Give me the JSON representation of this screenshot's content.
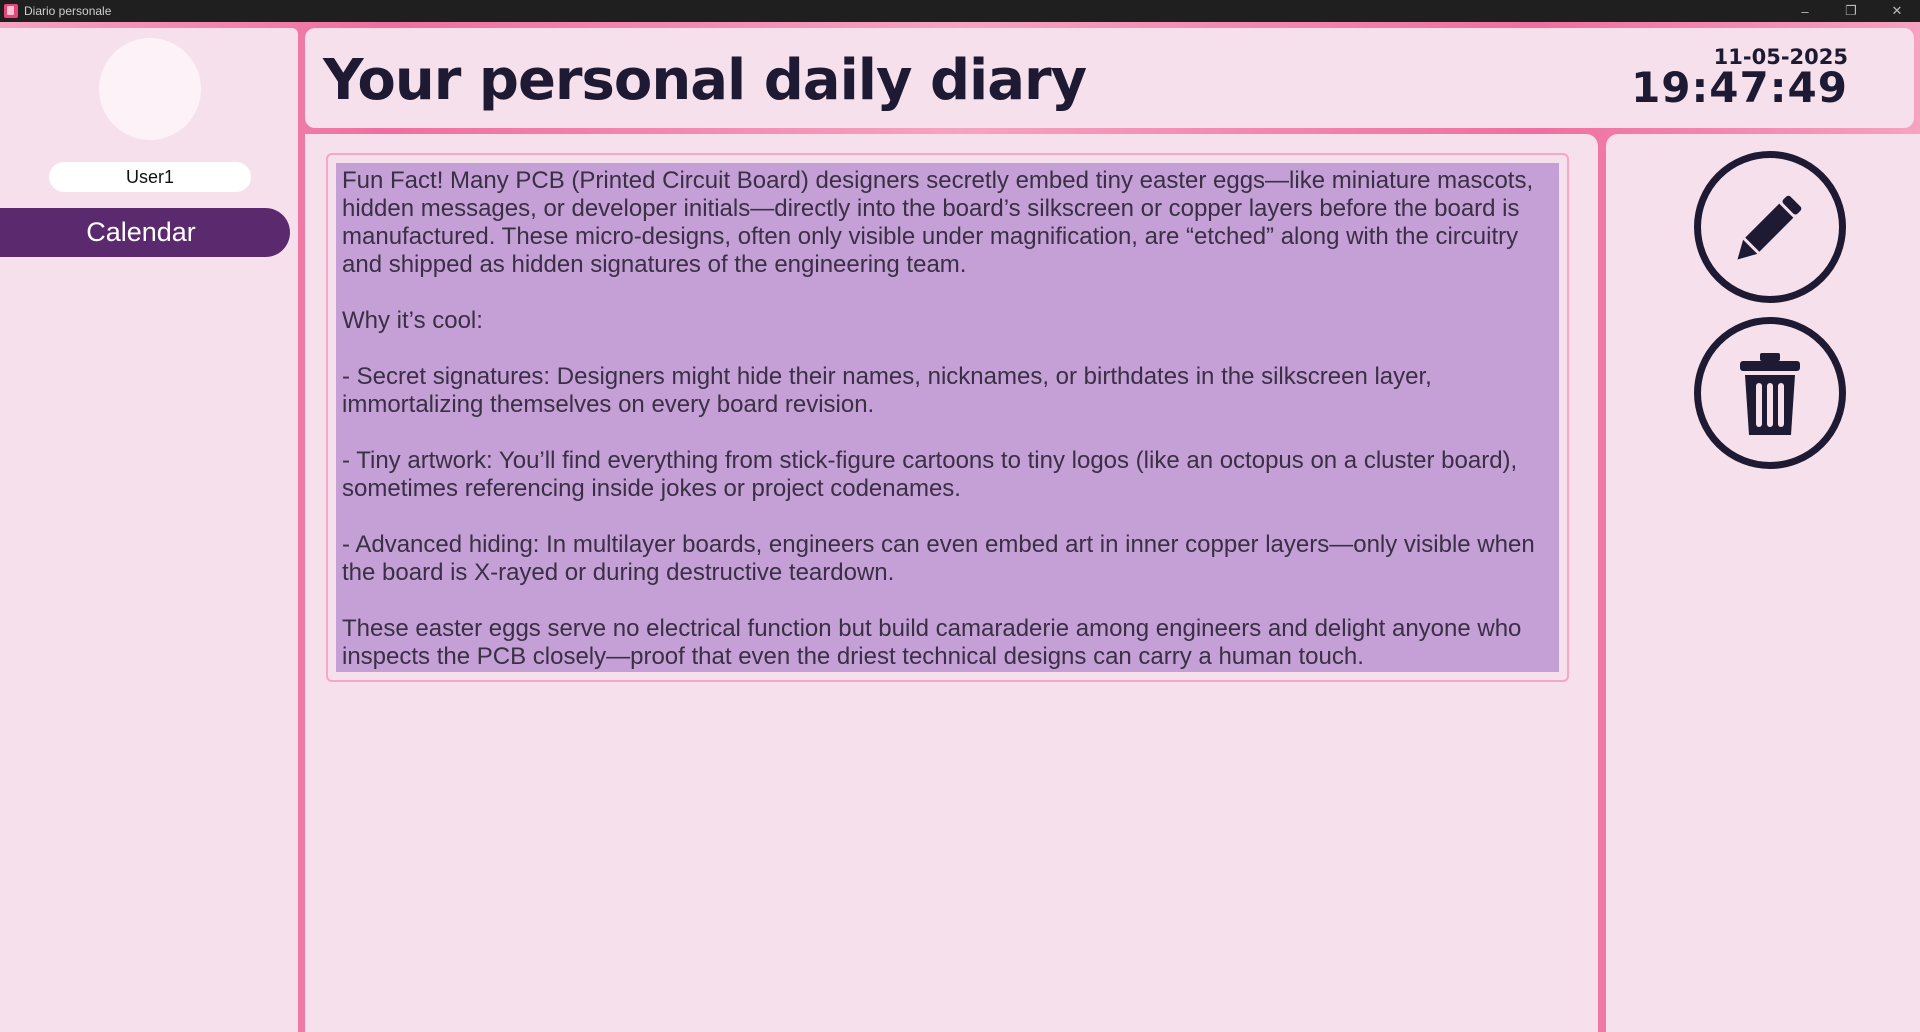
{
  "window": {
    "title": "Diario personale",
    "controls": {
      "minimize": "–",
      "restore": "❐",
      "close": "✕"
    }
  },
  "sidebar": {
    "username": "User1",
    "calendar_label": "Calendar"
  },
  "header": {
    "title": "Your personal daily diary",
    "date": "11-05-2025",
    "time": "19:47:49"
  },
  "entry": {
    "text": "Fun Fact! Many PCB (Printed Circuit Board) designers secretly embed tiny easter eggs—like miniature mascots, hidden messages, or developer initials—directly into the board’s silkscreen or copper layers before the board is manufactured. These micro-designs, often only visible under magnification, are “etched” along with the circuitry and shipped as hidden signatures of the engineering team.\n\nWhy it’s cool:\n\n- Secret signatures: Designers might hide their names, nicknames, or birthdates in the silkscreen layer, immortalizing themselves on every board revision.\n\n- Tiny artwork: You’ll find everything from stick-figure cartoons to tiny logos (like an octopus on a cluster board), sometimes referencing inside jokes or project codenames.\n\n- Advanced hiding: In multilayer boards, engineers can even embed art in inner copper layers—only visible when the board is X-rayed or during destructive teardown.\n\nThese easter eggs serve no electrical function but build camaraderie among engineers and delight anyone who inspects the PCB closely—proof that even the driest technical designs can carry a human touch."
  },
  "actions": {
    "edit_icon": "pencil-icon",
    "delete_icon": "trash-icon"
  },
  "colors": {
    "accent_purple": "#5b2a6e",
    "panel_bg": "#f5e0ec",
    "border_pink": "#f06b9c",
    "selection_bg": "#c4a0d6",
    "ink": "#1e1a33"
  }
}
